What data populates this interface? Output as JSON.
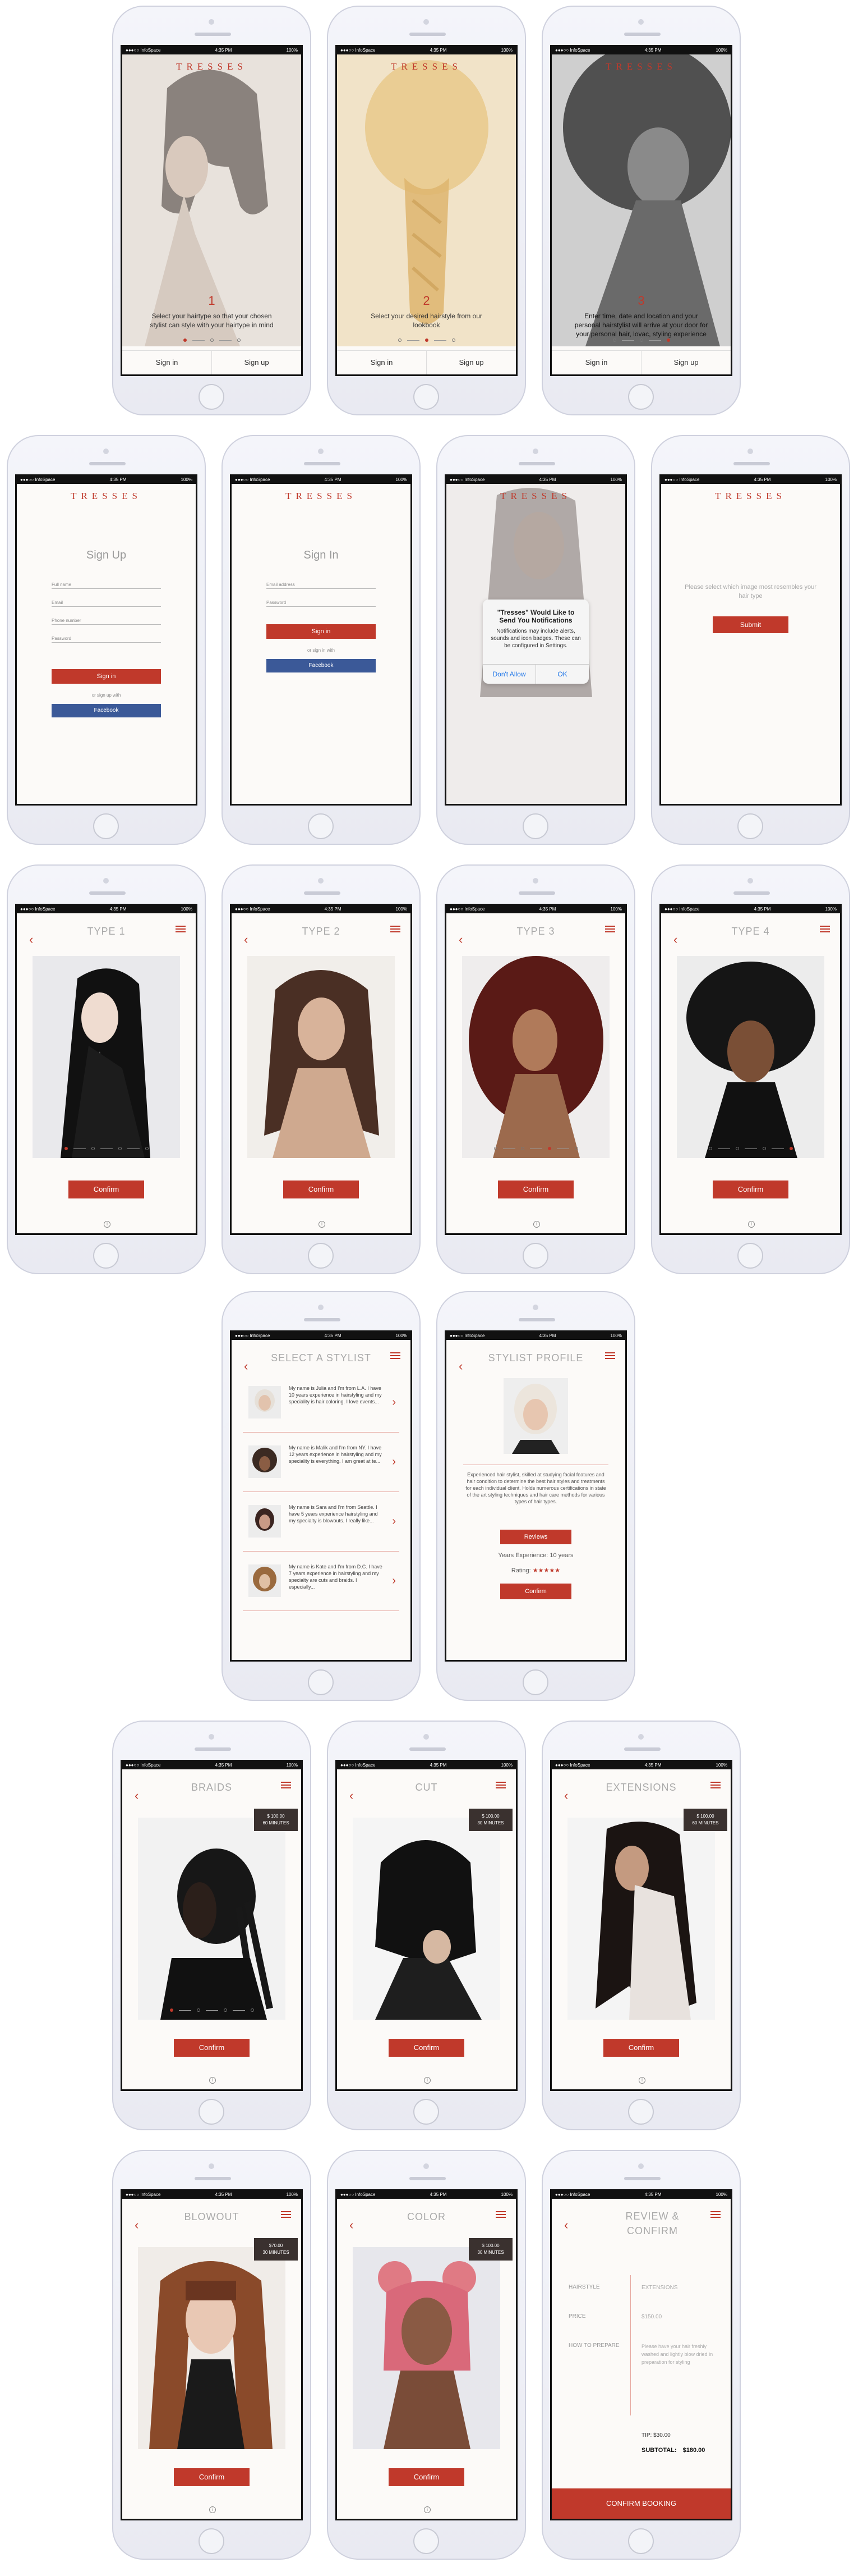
{
  "status": {
    "carrier": "●●●○○ InfoSpace",
    "time": "4:35 PM",
    "battery": "100%"
  },
  "brand": "TRESSES",
  "colors": {
    "accent": "#c0392b",
    "facebook": "#3b5998"
  },
  "onboarding": [
    {
      "num": "1",
      "text": "Select your hairtype so that your chosen stylist can style with your hairtype in mind"
    },
    {
      "num": "2",
      "text": "Select your desired hairstyle from our lookbook"
    },
    {
      "num": "3",
      "text": "Enter time, date and location and your personal hairstylist will arrive at your door for your personal hair, lovac, styling experience"
    }
  ],
  "signin_label": "Sign in",
  "signup_label": "Sign up",
  "signup": {
    "title": "Sign Up",
    "fields": [
      "Full name",
      "Email",
      "Phone number",
      "Password"
    ],
    "button": "Sign in",
    "or": "or sign up with",
    "facebook": "Facebook"
  },
  "signin": {
    "title": "Sign In",
    "fields": [
      "Email address",
      "Password"
    ],
    "button": "Sign in",
    "or": "or sign in with",
    "facebook": "Facebook"
  },
  "notification": {
    "title": "\"Tresses\" Would Like to Send You Notifications",
    "body": "Notifications may include alerts, sounds and icon badges. These can be configured in Settings.",
    "deny": "Don't Allow",
    "ok": "OK"
  },
  "select_image": {
    "text": "Please select which image most resembles your hair type",
    "button": "Submit"
  },
  "types": [
    {
      "title": "TYPE 1"
    },
    {
      "title": "TYPE 2"
    },
    {
      "title": "TYPE 3"
    },
    {
      "title": "TYPE 4"
    }
  ],
  "confirm_label": "Confirm",
  "select_stylist": {
    "title": "SELECT A STYLIST",
    "stylists": [
      {
        "bio": "My name is Julia and I'm from L.A. I have 10 years experience in hairstyling and my speciality is hair coloring. I love events..."
      },
      {
        "bio": "My name is Malik and I'm from NY. I have 12 years experience in hairstyling and my speciality is everything. I am great at te..."
      },
      {
        "bio": "My name is Sara and I'm from Seattle. I have 5 years experience hairstyling and my specialty is blowouts. I really like..."
      },
      {
        "bio": "My name is Kate and I'm from D.C. I have 7 years experience in hairstyling and my specialty are cuts and braids. I especially..."
      }
    ]
  },
  "stylist_profile": {
    "title": "STYLIST PROFILE",
    "bio": "Experienced hair stylist, skilled at studying facial features and hair condition to determine the best hair styles and treatments for each individual client. Holds numerous certifications in state of the art styling techniques and hair care methods for various types of hair types.",
    "reviews_button": "Reviews",
    "experience": "Years Experience: 10 years",
    "rating_label": "Rating:",
    "stars": "★★★★★",
    "confirm": "Confirm"
  },
  "styles": [
    {
      "title": "BRAIDS",
      "price": "$ 100.00",
      "duration": "60 MINUTES"
    },
    {
      "title": "CUT",
      "price": "$ 100.00",
      "duration": "30 MINUTES"
    },
    {
      "title": "EXTENSIONS",
      "price": "$ 100.00",
      "duration": "60 MINUTES"
    },
    {
      "title": "BLOWOUT",
      "price": "$70.00",
      "duration": "30 MINUTES"
    },
    {
      "title": "COLOR",
      "price": "$ 100.00",
      "duration": "30 MINUTES"
    }
  ],
  "review": {
    "title": "REVIEW & CONFIRM",
    "labels": [
      "HAIRSTYLE",
      "PRICE",
      "HOW TO PREPARE"
    ],
    "hairstyle": "EXTENSIONS",
    "price": "$150.00",
    "prepare": "Please have your hair freshly washed and lightly blow dried in preparation for styling",
    "tip": "TIP: $30.00",
    "subtotal_label": "SUBTOTAL:",
    "subtotal": "$180.00",
    "button": "CONFIRM BOOKING"
  }
}
